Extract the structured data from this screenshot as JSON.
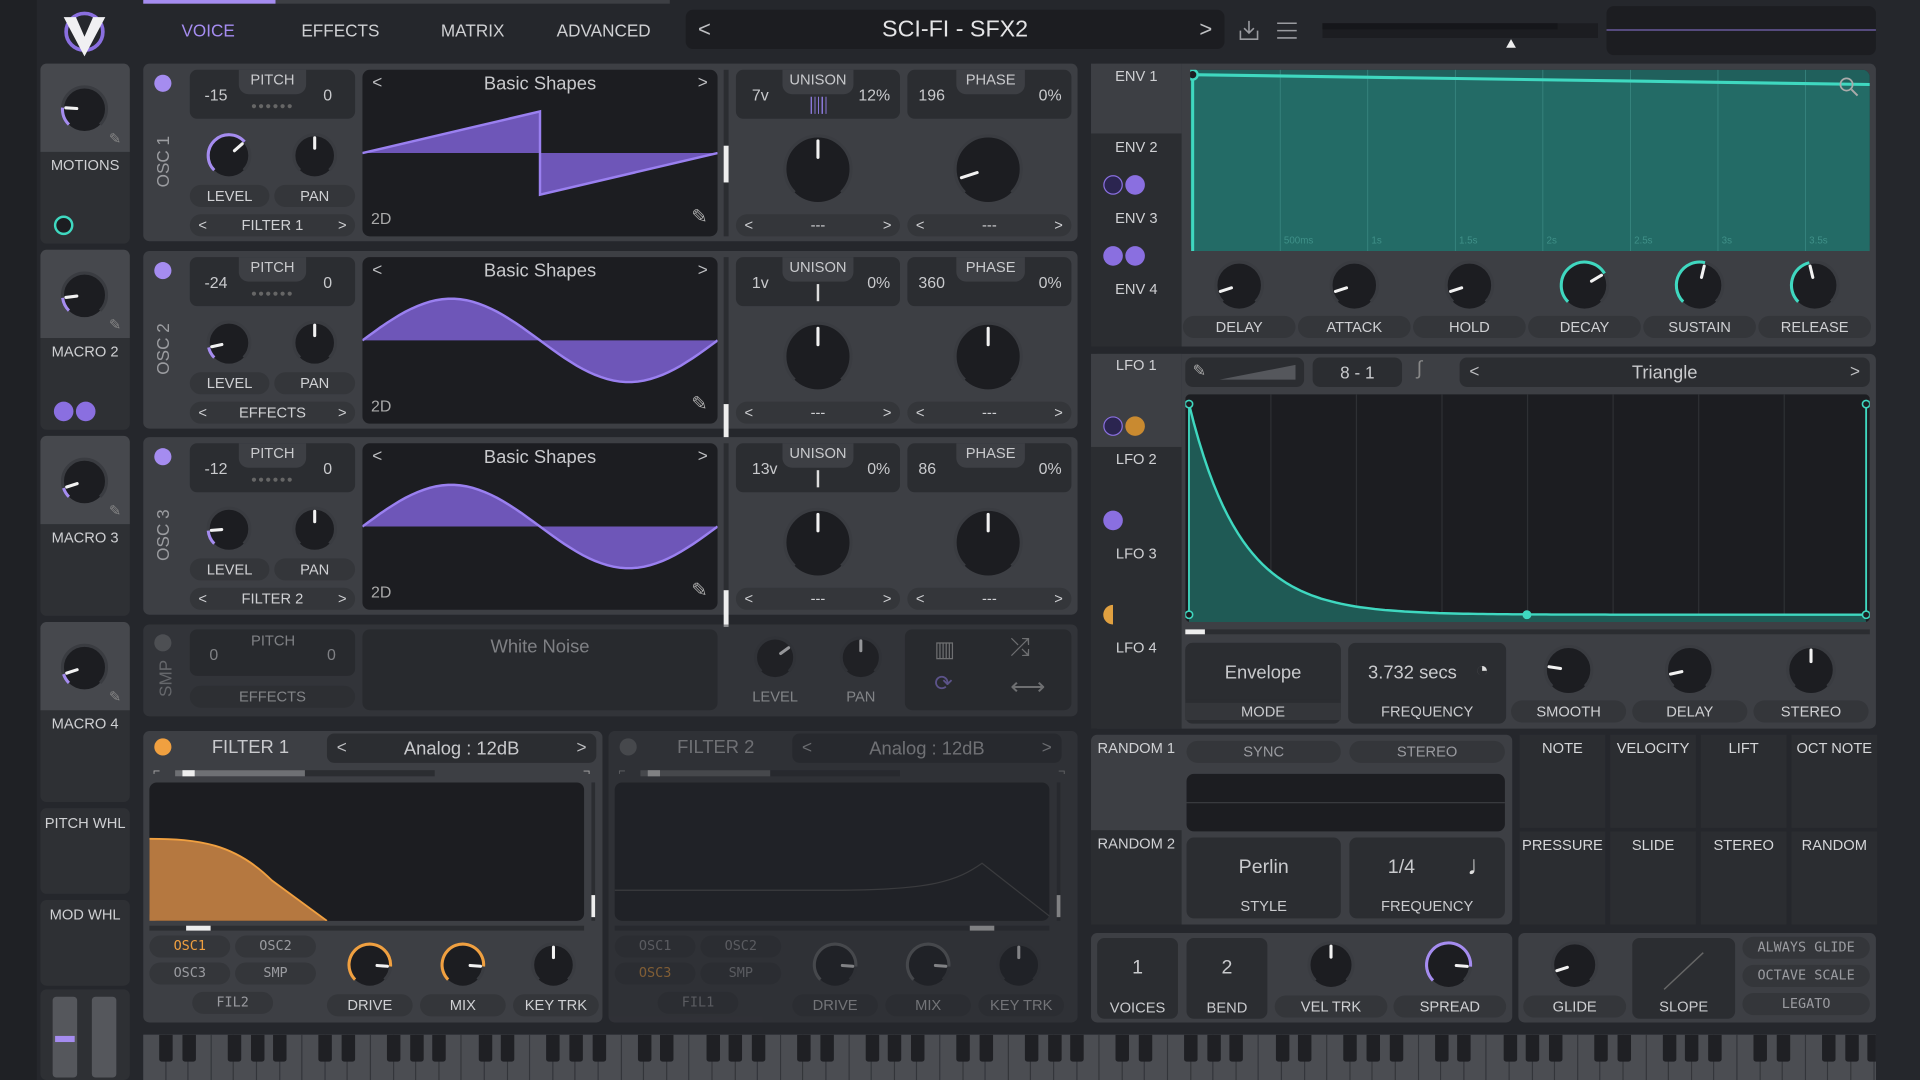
{
  "header": {
    "tabs": [
      "VOICE",
      "EFFECTS",
      "MATRIX",
      "ADVANCED"
    ],
    "active_tab": "VOICE",
    "preset": "SCI-FI - SFX2",
    "prev": "<",
    "next": ">",
    "icons": [
      "save-icon",
      "menu-icon"
    ]
  },
  "colors": {
    "accent": "#a58cf0",
    "env": "#3fd8c0",
    "filter": "#f0a040",
    "bg": "#25272c",
    "panel": "#3d3f44"
  },
  "macros": [
    {
      "label": "MOTIONS",
      "value": 0.18
    },
    {
      "label": "MACRO 2",
      "value": 0.14
    },
    {
      "label": "MACRO 3",
      "value": 0.1
    },
    {
      "label": "MACRO 4",
      "value": 0.1
    }
  ],
  "wheels": {
    "pitch": "PITCH WHL",
    "mod": "MOD WHL"
  },
  "oscillators": [
    {
      "name": "OSC 1",
      "pitch_label": "PITCH",
      "transpose": "-15",
      "tune": "0",
      "level_label": "LEVEL",
      "pan_label": "PAN",
      "destination": "FILTER 1",
      "wavetable": "Basic Shapes",
      "mode": "2D",
      "unison_label": "UNISON",
      "unison_voices": "7v",
      "unison_detune": "12%",
      "phase_label": "PHASE",
      "phase": "196",
      "phase_random": "0%",
      "spectral": "---",
      "distortion": "---",
      "level": 0.68,
      "pan": 0.5,
      "unison_knob": 0.5,
      "phase_knob": 0.1
    },
    {
      "name": "OSC 2",
      "pitch_label": "PITCH",
      "transpose": "-24",
      "tune": "0",
      "level_label": "LEVEL",
      "pan_label": "PAN",
      "destination": "EFFECTS",
      "wavetable": "Basic Shapes",
      "mode": "2D",
      "unison_label": "UNISON",
      "unison_voices": "1v",
      "unison_detune": "0%",
      "phase_label": "PHASE",
      "phase": "360",
      "phase_random": "0%",
      "spectral": "---",
      "distortion": "---",
      "level": 0.12,
      "pan": 0.5,
      "unison_knob": 0.5,
      "phase_knob": 0.5
    },
    {
      "name": "OSC 3",
      "pitch_label": "PITCH",
      "transpose": "-12",
      "tune": "0",
      "level_label": "LEVEL",
      "pan_label": "PAN",
      "destination": "FILTER 2",
      "wavetable": "Basic Shapes",
      "mode": "2D",
      "unison_label": "UNISON",
      "unison_voices": "13v",
      "unison_detune": "0%",
      "phase_label": "PHASE",
      "phase": "86",
      "phase_random": "0%",
      "spectral": "---",
      "distortion": "---",
      "level": 0.15,
      "pan": 0.5,
      "unison_knob": 0.5,
      "phase_knob": 0.5
    }
  ],
  "sampler": {
    "name": "SMP",
    "pitch_label": "PITCH",
    "transpose": "0",
    "tune": "0",
    "destination": "EFFECTS",
    "sample": "White Noise",
    "level_label": "LEVEL",
    "pan_label": "PAN",
    "level": 0.7,
    "pan": 0.5
  },
  "filters": [
    {
      "name": "FILTER 1",
      "model": "Analog : 12dB",
      "enabled": true,
      "sources": [
        "OSC1",
        "OSC2",
        "OSC3",
        "SMP",
        "FIL2"
      ],
      "active_sources": [
        "OSC1"
      ],
      "drive_label": "DRIVE",
      "mix_label": "MIX",
      "keytrack_label": "KEY TRK",
      "drive": 0.85,
      "mix": 0.85,
      "keytrack": 0.5
    },
    {
      "name": "FILTER 2",
      "model": "Analog : 12dB",
      "enabled": false,
      "sources": [
        "OSC1",
        "OSC2",
        "OSC3",
        "SMP",
        "FIL1"
      ],
      "active_sources": [
        "OSC3"
      ],
      "drive_label": "DRIVE",
      "mix_label": "MIX",
      "keytrack_label": "KEY TRK",
      "drive": 0.85,
      "mix": 0.85,
      "keytrack": 0.5
    }
  ],
  "envelopes": {
    "tabs": [
      "ENV 1",
      "ENV 2",
      "ENV 3",
      "ENV 4"
    ],
    "active": "ENV 1",
    "time_ticks": [
      "500ms",
      "1s",
      "1.5s",
      "2s",
      "2.5s",
      "3s",
      "3.5s"
    ],
    "knobs": [
      {
        "label": "DELAY",
        "value": 0.1
      },
      {
        "label": "ATTACK",
        "value": 0.1
      },
      {
        "label": "HOLD",
        "value": 0.1
      },
      {
        "label": "DECAY",
        "value": 0.72
      },
      {
        "label": "SUSTAIN",
        "value": 0.55
      },
      {
        "label": "RELEASE",
        "value": 0.45
      }
    ]
  },
  "lfos": {
    "tabs": [
      "LFO 1",
      "LFO 2",
      "LFO 3",
      "LFO 4"
    ],
    "active": "LFO 1",
    "grid": "8 - 1",
    "grid_sep": "-",
    "grid_x": "8",
    "grid_y": "1",
    "shape": "Triangle",
    "mode_value": "Envelope",
    "mode_label": "MODE",
    "frequency_value": "3.732 secs",
    "frequency_label": "FREQUENCY",
    "knobs": [
      {
        "label": "SMOOTH",
        "value": 0.2
      },
      {
        "label": "DELAY",
        "value": 0.12
      },
      {
        "label": "STEREO",
        "value": 0.5
      }
    ]
  },
  "random": {
    "tabs": [
      "RANDOM 1",
      "RANDOM 2"
    ],
    "sync": "SYNC",
    "stereo": "STEREO",
    "style_value": "Perlin",
    "style_label": "STYLE",
    "frequency_value": "1/4",
    "frequency_label": "FREQUENCY"
  },
  "mod_sources": [
    "NOTE",
    "VELOCITY",
    "LIFT",
    "OCT NOTE",
    "PRESSURE",
    "SLIDE",
    "STEREO",
    "RANDOM"
  ],
  "voice": {
    "voices": "1",
    "voices_label": "VOICES",
    "bend": "2",
    "bend_label": "BEND",
    "vel_trk_label": "VEL TRK",
    "vel_trk": 0.5,
    "spread_label": "SPREAD",
    "spread": 0.85
  },
  "glide": {
    "glide_label": "GLIDE",
    "glide": 0.1,
    "slope_label": "SLOPE",
    "always_glide": "ALWAYS GLIDE",
    "octave_scale": "OCTAVE SCALE",
    "legato": "LEGATO"
  }
}
